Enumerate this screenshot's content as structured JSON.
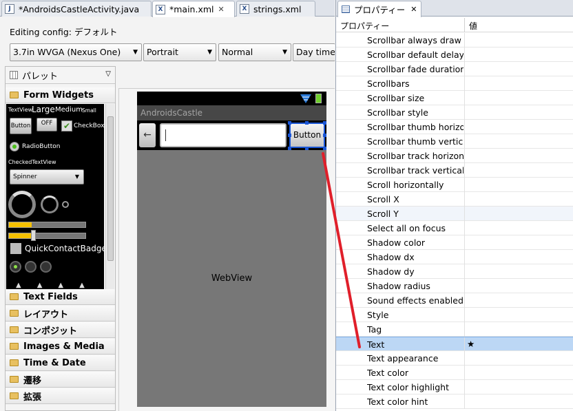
{
  "editor": {
    "tabs": [
      {
        "label": "*AndroidsCastleActivity.java",
        "icon": "java-file-icon"
      },
      {
        "label": "*main.xml",
        "icon": "xml-file-icon"
      },
      {
        "label": "strings.xml",
        "icon": "xml-file-icon"
      }
    ],
    "tab_close_glyph": "✕",
    "config_label": "Editing config: デフォルト",
    "combos": [
      "3.7in WVGA (Nexus One)",
      "Portrait",
      "Normal",
      "Day time"
    ]
  },
  "palette": {
    "title": "パレット",
    "form_widgets": "Form Widgets",
    "widget_texts": {
      "textview": "TextView",
      "large": "Large",
      "medium": "Medium",
      "small": "Small",
      "button": "Button",
      "off": "OFF",
      "checkbox": "CheckBox",
      "radiobutton": "RadioButton",
      "checkedtextview": "CheckedTextView",
      "spinner": "Spinner",
      "quickcontactbadge": "QuickContactBadge"
    },
    "categories": [
      "Text Fields",
      "レイアウト",
      "コンポジット",
      "Images & Media",
      "Time & Date",
      "遷移",
      "拡張"
    ],
    "progress_fill": [
      0.3,
      0.3
    ]
  },
  "device": {
    "app_title": "AndroidsCastle",
    "back_glyph": "←",
    "button_label": "Button",
    "webview_label": "WebView"
  },
  "properties": {
    "tab_title": "プロパティー",
    "header_property": "プロパティー",
    "header_value": "値",
    "rows": [
      {
        "name": "Scrollbar always draw vertical track",
        "value": ""
      },
      {
        "name": "Scrollbar default delay before fade",
        "value": ""
      },
      {
        "name": "Scrollbar fade duration",
        "value": ""
      },
      {
        "name": "Scrollbars",
        "value": ""
      },
      {
        "name": "Scrollbar size",
        "value": ""
      },
      {
        "name": "Scrollbar style",
        "value": ""
      },
      {
        "name": "Scrollbar thumb horizontal",
        "value": ""
      },
      {
        "name": "Scrollbar thumb vertical",
        "value": ""
      },
      {
        "name": "Scrollbar track horizontal",
        "value": ""
      },
      {
        "name": "Scrollbar track vertical",
        "value": ""
      },
      {
        "name": "Scroll horizontally",
        "value": ""
      },
      {
        "name": "Scroll X",
        "value": ""
      },
      {
        "name": "Scroll Y",
        "value": ""
      },
      {
        "name": "Select all on focus",
        "value": ""
      },
      {
        "name": "Shadow color",
        "value": ""
      },
      {
        "name": "Shadow dx",
        "value": ""
      },
      {
        "name": "Shadow dy",
        "value": ""
      },
      {
        "name": "Shadow radius",
        "value": ""
      },
      {
        "name": "Sound effects enabled",
        "value": ""
      },
      {
        "name": "Style",
        "value": ""
      },
      {
        "name": "Tag",
        "value": ""
      },
      {
        "name": "Text",
        "value": "★"
      },
      {
        "name": "Text appearance",
        "value": ""
      },
      {
        "name": "Text color",
        "value": ""
      },
      {
        "name": "Text color highlight",
        "value": ""
      },
      {
        "name": "Text color hint",
        "value": ""
      }
    ]
  },
  "colors": {
    "selection_blue": "#1b57d6",
    "annotation_red": "#e01f2a",
    "selected_row": "#bcd7f5"
  }
}
